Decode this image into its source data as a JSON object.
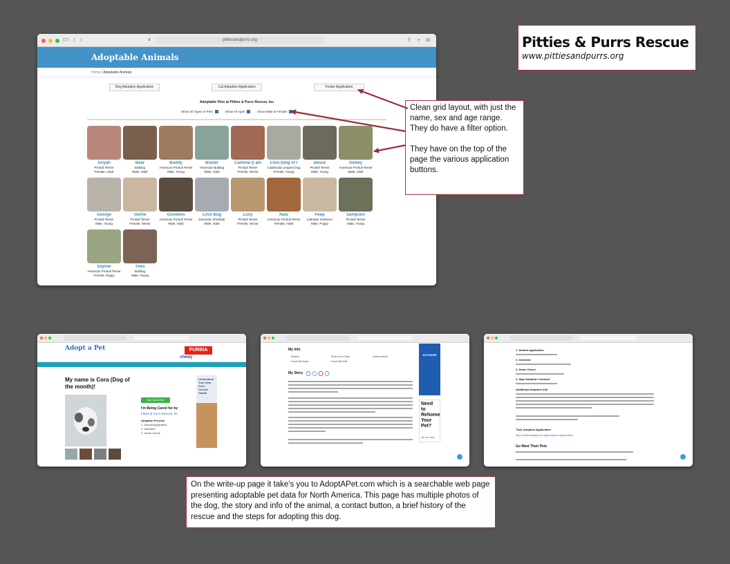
{
  "title_box": {
    "title": "Pitties & Purrs Rescue",
    "site": "www.pittiesandpurrs.org"
  },
  "main_window": {
    "url": "pittiesandpurrs.org",
    "hero_title": "Adoptable Animals",
    "breadcrumb_home": "Home",
    "breadcrumb_current": "/ Adoptable Animals",
    "app_buttons": [
      "Dog Adoption Application",
      "Cat Adoption Application",
      "Foster Application"
    ],
    "rescue_title": "Adoptable Pets at Pitties & Purrs Rescue, Inc",
    "filters": [
      "Show All Types of Pets",
      "Show All Ages",
      "Show Male & Female"
    ],
    "pets": [
      {
        "name": "Ariyah",
        "breed": "Pit Bull Terrier",
        "info": "Female, Adult",
        "color": "#b9867b"
      },
      {
        "name": "Bear",
        "breed": "Bulldog",
        "info": "Male, Adult",
        "color": "#7a5f4d"
      },
      {
        "name": "Buddy",
        "breed": "American Pit Bull Terrier",
        "info": "Male, Young",
        "color": "#9c7b5f"
      },
      {
        "name": "Buster",
        "breed": "American Bulldog",
        "info": "Male, Adult",
        "color": "#8aa39a"
      },
      {
        "name": "Cammie (I am",
        "breed": "Pit Bull Terrier",
        "info": "Female, Senior",
        "color": "#a06a54"
      },
      {
        "name": "Cora (Dog of t",
        "breed": "Catahoula Leopard Dog",
        "info": "Female, Young",
        "color": "#a9a9a0"
      },
      {
        "name": "Deuce",
        "breed": "Pit Bull Terrier",
        "info": "Male, Young",
        "color": "#6d6a5c"
      },
      {
        "name": "Dewey",
        "breed": "American Pit Bull Terrier",
        "info": "Male, Adult",
        "color": "#8d8f68"
      },
      {
        "name": "George",
        "breed": "Pit Bull Terrier",
        "info": "Male, Young",
        "color": "#b8b2a9"
      },
      {
        "name": "Gertie",
        "breed": "Pit Bull Terrier",
        "info": "Female, Senior",
        "color": "#c9b7a2"
      },
      {
        "name": "Goodwin",
        "breed": "American Pit Bull Terrier",
        "info": "Male, Adult",
        "color": "#5a4c3e"
      },
      {
        "name": "Love Bug",
        "breed": "Domestic Shorthair",
        "info": "Male, Adult",
        "color": "#a6aab1"
      },
      {
        "name": "Lucy",
        "breed": "Pit Bull Terrier",
        "info": "Female, Senior",
        "color": "#b99870"
      },
      {
        "name": "Nala",
        "breed": "American Pit Bull Terrier",
        "info": "Female, Adult",
        "color": "#a4683e"
      },
      {
        "name": "Peep",
        "breed": "Labrador Retriever",
        "info": "Male, Puppy",
        "color": "#c9b9a1"
      },
      {
        "name": "Sampson",
        "breed": "Pit Bull Terrier",
        "info": "Male, Young",
        "color": "#6e7159"
      },
      {
        "name": "Sophie",
        "breed": "American Pit Bull Terrier",
        "info": "Female, Puppy",
        "color": "#9aa583"
      },
      {
        "name": "Theo",
        "breed": "Bulldog",
        "info": "Male, Young",
        "color": "#7d6456"
      }
    ]
  },
  "note_grid": {
    "para1": "Clean grid layout, with just the name, sex and age range. They do have a filter option.",
    "para2": "They have on the top of the page the various application buttons."
  },
  "note_bottom": {
    "text": "On the write-up page it take's you to AdoptAPet.com which is a searchable web page presenting adoptable pet data for North America. This page has multiple photos of the dog, the story and info of the animal, a contact button, a brief history of the rescue and the steps for adopting this dog."
  },
  "shot1": {
    "logo": "Adopt a Pet",
    "purina": "PURINA",
    "chewy": "chewy",
    "cora_title": "My name is Cora (Dog of the month)!",
    "ask_button": "Ask About Me",
    "care_title": "I'm Being Cared for by",
    "care_link": "Pitties & Purrs Rescue, Inc",
    "process_title": "Adoption Process",
    "process_steps": [
      "1. Submit Application",
      "2. Interview",
      "3. Home Check"
    ],
    "ad_text": "Understand Your New Pet's Overall Health"
  },
  "shot2": {
    "info_title": "My Info",
    "options": [
      "Spayed",
      "Shots Up to Date",
      "House-trained",
      "Good with Dogs",
      "Good with Kids"
    ],
    "story_title": "My Story",
    "ad_top": "AUTOSHIP",
    "rehome_title": "Need to Rehome Your Pet?",
    "rehome_sub": "We can help."
  },
  "shot3": {
    "steps": [
      "1. Submit Application",
      "2. Interview",
      "3. Home Check",
      "4. Sign Adoption Contract"
    ],
    "info_title": "Additional Adoption Info",
    "their_app": "Their Adoption Application",
    "app_link": "https://pittiesandpurrs.org/adoption-application/",
    "meet_title": "Go Meet Their Pets"
  }
}
